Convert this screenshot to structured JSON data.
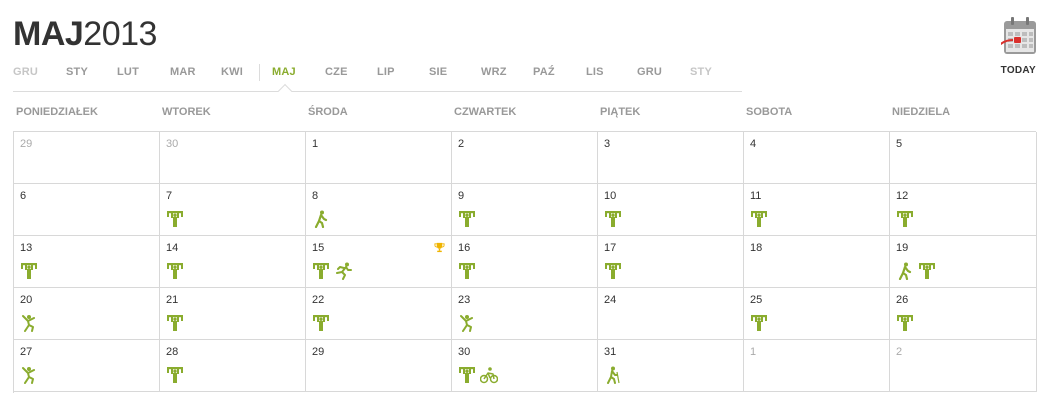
{
  "header": {
    "month": "MAJ",
    "year": "2013"
  },
  "months": [
    {
      "label": "GRU",
      "dim": true
    },
    {
      "label": "STY"
    },
    {
      "label": "LUT"
    },
    {
      "label": "MAR"
    },
    {
      "label": "KWI"
    },
    {
      "label": "MAJ",
      "active": true
    },
    {
      "label": "CZE"
    },
    {
      "label": "LIP"
    },
    {
      "label": "SIE"
    },
    {
      "label": "WRZ"
    },
    {
      "label": "PAŹ"
    },
    {
      "label": "LIS"
    },
    {
      "label": "GRU"
    },
    {
      "label": "STY",
      "dim": true
    }
  ],
  "today_label": "TODAY",
  "weekdays": [
    "PONIEDZIAŁEK",
    "WTOREK",
    "ŚRODA",
    "CZWARTEK",
    "PIĄTEK",
    "SOBOTA",
    "NIEDZIELA"
  ],
  "colors": {
    "accent": "#8aac2e",
    "trophy": "#f0b400",
    "today_red": "#d9302c"
  },
  "weeks": [
    [
      {
        "day": "29",
        "other": true
      },
      {
        "day": "30",
        "other": true
      },
      {
        "day": "1"
      },
      {
        "day": "2"
      },
      {
        "day": "3"
      },
      {
        "day": "4"
      },
      {
        "day": "5"
      }
    ],
    [
      {
        "day": "6"
      },
      {
        "day": "7",
        "acts": [
          "strength-icon"
        ]
      },
      {
        "day": "8",
        "acts": [
          "walking-icon"
        ]
      },
      {
        "day": "9",
        "acts": [
          "strength-icon"
        ]
      },
      {
        "day": "10",
        "acts": [
          "strength-icon"
        ]
      },
      {
        "day": "11",
        "acts": [
          "strength-icon"
        ]
      },
      {
        "day": "12",
        "acts": [
          "strength-icon"
        ]
      }
    ],
    [
      {
        "day": "13",
        "acts": [
          "strength-icon"
        ]
      },
      {
        "day": "14",
        "acts": [
          "strength-icon"
        ]
      },
      {
        "day": "15",
        "acts": [
          "strength-icon",
          "running-icon"
        ],
        "trophy": true
      },
      {
        "day": "16",
        "acts": [
          "strength-icon"
        ]
      },
      {
        "day": "17",
        "acts": [
          "strength-icon"
        ]
      },
      {
        "day": "18"
      },
      {
        "day": "19",
        "acts": [
          "walking-icon",
          "strength-icon"
        ]
      }
    ],
    [
      {
        "day": "20",
        "acts": [
          "aerobics-icon"
        ]
      },
      {
        "day": "21",
        "acts": [
          "strength-icon"
        ]
      },
      {
        "day": "22",
        "acts": [
          "strength-icon"
        ]
      },
      {
        "day": "23",
        "acts": [
          "aerobics-icon"
        ]
      },
      {
        "day": "24"
      },
      {
        "day": "25",
        "acts": [
          "strength-icon"
        ]
      },
      {
        "day": "26",
        "acts": [
          "strength-icon"
        ]
      }
    ],
    [
      {
        "day": "27",
        "acts": [
          "aerobics-icon"
        ]
      },
      {
        "day": "28",
        "acts": [
          "strength-icon"
        ]
      },
      {
        "day": "29"
      },
      {
        "day": "30",
        "acts": [
          "strength-icon",
          "cycling-icon"
        ]
      },
      {
        "day": "31",
        "acts": [
          "nordic-walking-icon"
        ]
      },
      {
        "day": "1",
        "other": true
      },
      {
        "day": "2",
        "other": true
      }
    ]
  ]
}
